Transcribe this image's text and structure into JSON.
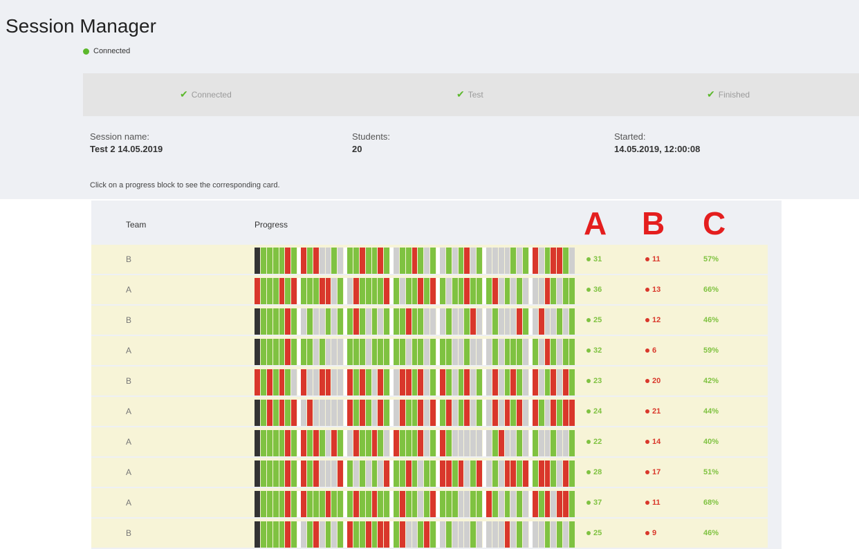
{
  "app": {
    "title": "Session Manager",
    "status": "Connected",
    "status_color": "#5cb82c"
  },
  "steps": [
    "Connected",
    "Test",
    "Finished"
  ],
  "session": {
    "name_label": "Session name:",
    "name": "Test 2 14.05.2019",
    "students_label": "Students:",
    "students": "20",
    "started_label": "Started:",
    "started": "14.05.2019, 12:00:08"
  },
  "hint": "Click on a progress block to see the corresponding card.",
  "table": {
    "headers": {
      "team": "Team",
      "progress": "Progress"
    },
    "annotations": [
      "A",
      "B",
      "C"
    ],
    "rows": [
      {
        "team": "B",
        "correct": "31",
        "wrong": "11",
        "percent": "57%",
        "progress": "kggggrgrgrwwgwggrggrgwggrgwgwgwgrwgwwwwgwgrwgrrgw"
      },
      {
        "team": "A",
        "correct": "36",
        "wrong": "13",
        "percent": "66%",
        "progress": "rgggrgrgggrrwgwrggggrgwggrgrgwggrgggrwgwgwwwrgwgg"
      },
      {
        "team": "B",
        "correct": "25",
        "wrong": "12",
        "percent": "46%",
        "progress": "kggggrgwgwwgwggrgwgwgggrggwwwgwwgrwwgwwwrgwrwwgwg"
      },
      {
        "team": "A",
        "correct": "32",
        "wrong": "6",
        "percent": "59%",
        "progress": "kggggrgggwgwwwgggwgggggwggwgggwwgwwwgwgggwgwrgwgg"
      },
      {
        "team": "B",
        "correct": "23",
        "wrong": "20",
        "percent": "42%",
        "progress": "rgrgrgwrwwrrwwrgrgwrgwrrgrwgrgwgrwgwrwgrgwrwgrwrg"
      },
      {
        "team": "A",
        "correct": "24",
        "wrong": "21",
        "percent": "44%",
        "progress": "kgrgrgrwrwwwwwrgrgwrgwrggrwrgrwgrwgwrwrgrwrgwrgrr"
      },
      {
        "team": "A",
        "correct": "22",
        "wrong": "14",
        "percent": "40%",
        "progress": "kggggrgrgrgwrgwrggrgwrgggrwgrgwwwwwwgrwwgwgwwgwwg"
      },
      {
        "team": "A",
        "correct": "28",
        "wrong": "17",
        "percent": "51%",
        "progress": "kggggrgrgrwwwrgwgwgwrggrgwggrrgrwgrwgwrrgrgrrgwrg"
      },
      {
        "team": "A",
        "correct": "37",
        "wrong": "11",
        "percent": "68%",
        "progress": "kggggrgrgggrgggrggrgggrggwgrgggwwggrgwgwgwrgrwrrg"
      },
      {
        "team": "B",
        "correct": "25",
        "wrong": "9",
        "percent": "46%",
        "progress": "kggggrgwgrwgwgrggrgrrgrwwgrgwgwwwgwwwwrwgwwwgwgwg"
      }
    ]
  }
}
